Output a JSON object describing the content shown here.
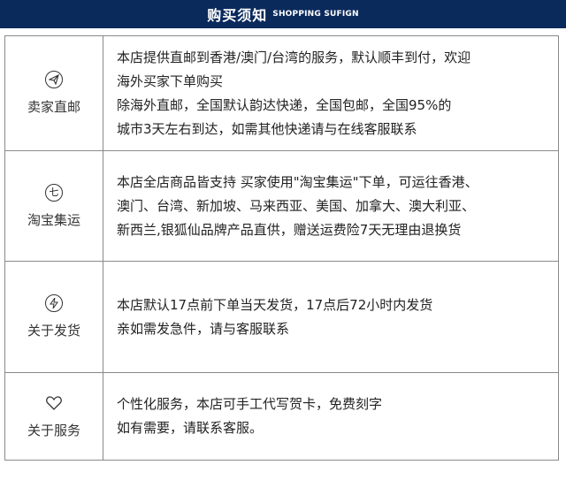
{
  "header": {
    "title": "购买须知",
    "subtitle": "SHOPPING SUFIGN"
  },
  "rows": [
    {
      "icon": "paper-plane-icon",
      "label": "卖家直邮",
      "lines": [
        "本店提供直邮到香港/澳门/台湾的服务，默认顺丰到付，欢迎",
        "海外买家下单购买",
        "除海外直邮，全国默认韵达快递，全国包邮，全国95%的",
        "城市3天左右到达，如需其他快递请与在线客服联系"
      ]
    },
    {
      "icon": "seven-icon",
      "icon_text": "七",
      "label": "淘宝集运",
      "lines": [
        "本店全店商品皆支持 买家使用\"淘宝集运\"下单，可运往香港、",
        "澳门、台湾、新加坡、马来西亚、美国、加拿大、澳大利亚、",
        "新西兰,银狐仙品牌产品直供，赠送运费险7天无理由退换货"
      ]
    },
    {
      "icon": "lightning-icon",
      "label": "关于发货",
      "lines": [
        "本店默认17点前下单当天发货，17点后72小时内发货",
        "亲如需发急件，请与客服联系"
      ]
    },
    {
      "icon": "heart-icon",
      "label": "关于服务",
      "lines": [
        "个性化服务，本店可手工代写贺卡，免费刻字",
        "如有需要，请联系客服。"
      ]
    }
  ]
}
